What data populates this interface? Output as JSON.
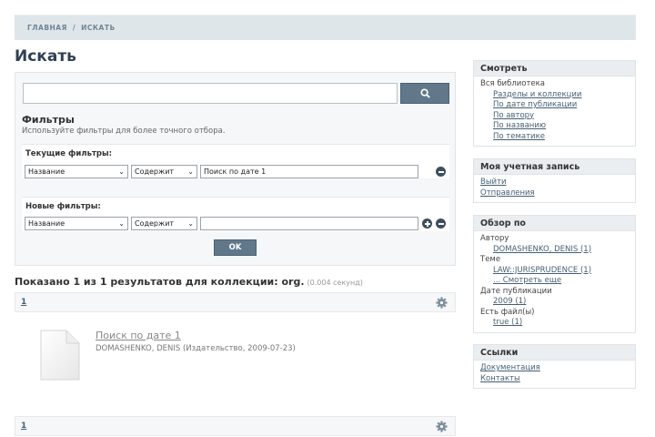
{
  "breadcrumb": {
    "home": "ГЛАВНАЯ",
    "separator": "/",
    "current": "ИСКАТЬ"
  },
  "page_title": "Искать",
  "search": {
    "query_value": "",
    "button_icon": "search-icon"
  },
  "filters": {
    "heading": "Фильтры",
    "hint": "Используйте фильтры для более точного отбора.",
    "current_heading": "Текущие фильтры:",
    "current": {
      "field": "Название",
      "operator": "Содержит",
      "value": "Поиск по дате 1"
    },
    "new_heading": "Новые фильтры:",
    "new": {
      "field": "Название",
      "operator": "Содержит",
      "value": ""
    },
    "ok_label": "OK"
  },
  "results": {
    "heading": "Показано 1 из 1 результатов для коллекции: org.",
    "time": "(0.004 секунд)",
    "page": "1",
    "item": {
      "title": "Поиск по дате 1",
      "meta": "DOMASHENKO, DENIS (Издательство, 2009-07-23)"
    }
  },
  "sidebar": {
    "browse": {
      "title": "Смотреть",
      "all_label": "Вся библиотека",
      "links": [
        "Разделы и коллекции",
        "По дате публикации",
        "По автору",
        "По названию",
        "По тематике"
      ]
    },
    "account": {
      "title": "Моя учетная запись",
      "links": [
        "Выйти",
        "Отправления"
      ]
    },
    "facets": {
      "title": "Обзор по",
      "author_label": "Автору",
      "author_value": "DOMASHENKO, DENIS (1)",
      "subject_label": "Теме",
      "subject_value": "LAW::JURISPRUDENCE (1)",
      "subject_more": "... Смотреть еще",
      "date_label": "Дате публикации",
      "date_value": "2009 (1)",
      "file_label": "Есть файл(ы)",
      "file_value": "true (1)"
    },
    "links_box": {
      "title": "Ссылки",
      "links": [
        "Документация",
        "Контакты"
      ]
    }
  },
  "colors": {
    "primary_button": "#60788a",
    "link": "#465f73",
    "header_band": "#dfe6ea"
  }
}
